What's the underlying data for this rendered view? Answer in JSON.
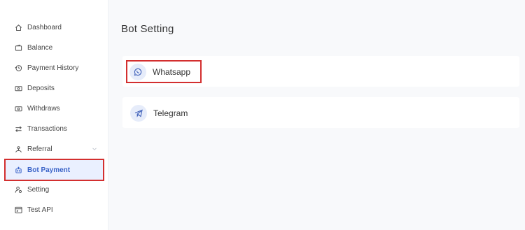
{
  "sidebar": {
    "items": [
      {
        "label": "Dashboard",
        "icon": "home-icon"
      },
      {
        "label": "Balance",
        "icon": "wallet-icon"
      },
      {
        "label": "Payment History",
        "icon": "history-icon"
      },
      {
        "label": "Deposits",
        "icon": "money-icon"
      },
      {
        "label": "Withdraws",
        "icon": "money-icon"
      },
      {
        "label": "Transactions",
        "icon": "transfer-icon"
      },
      {
        "label": "Referral",
        "icon": "referral-icon"
      },
      {
        "label": "Bot Payment",
        "icon": "robot-icon"
      },
      {
        "label": "Setting",
        "icon": "user-settings-icon"
      },
      {
        "label": "Test API",
        "icon": "terminal-icon"
      }
    ],
    "active": "Bot Payment"
  },
  "main": {
    "title": "Bot Setting",
    "bots": [
      {
        "label": "Whatsapp",
        "icon": "whatsapp-icon"
      },
      {
        "label": "Telegram",
        "icon": "telegram-icon"
      }
    ]
  },
  "colors": {
    "accent": "#3a63c8",
    "highlight_border": "#d32f2f",
    "active_bg": "#eaf0ff"
  }
}
